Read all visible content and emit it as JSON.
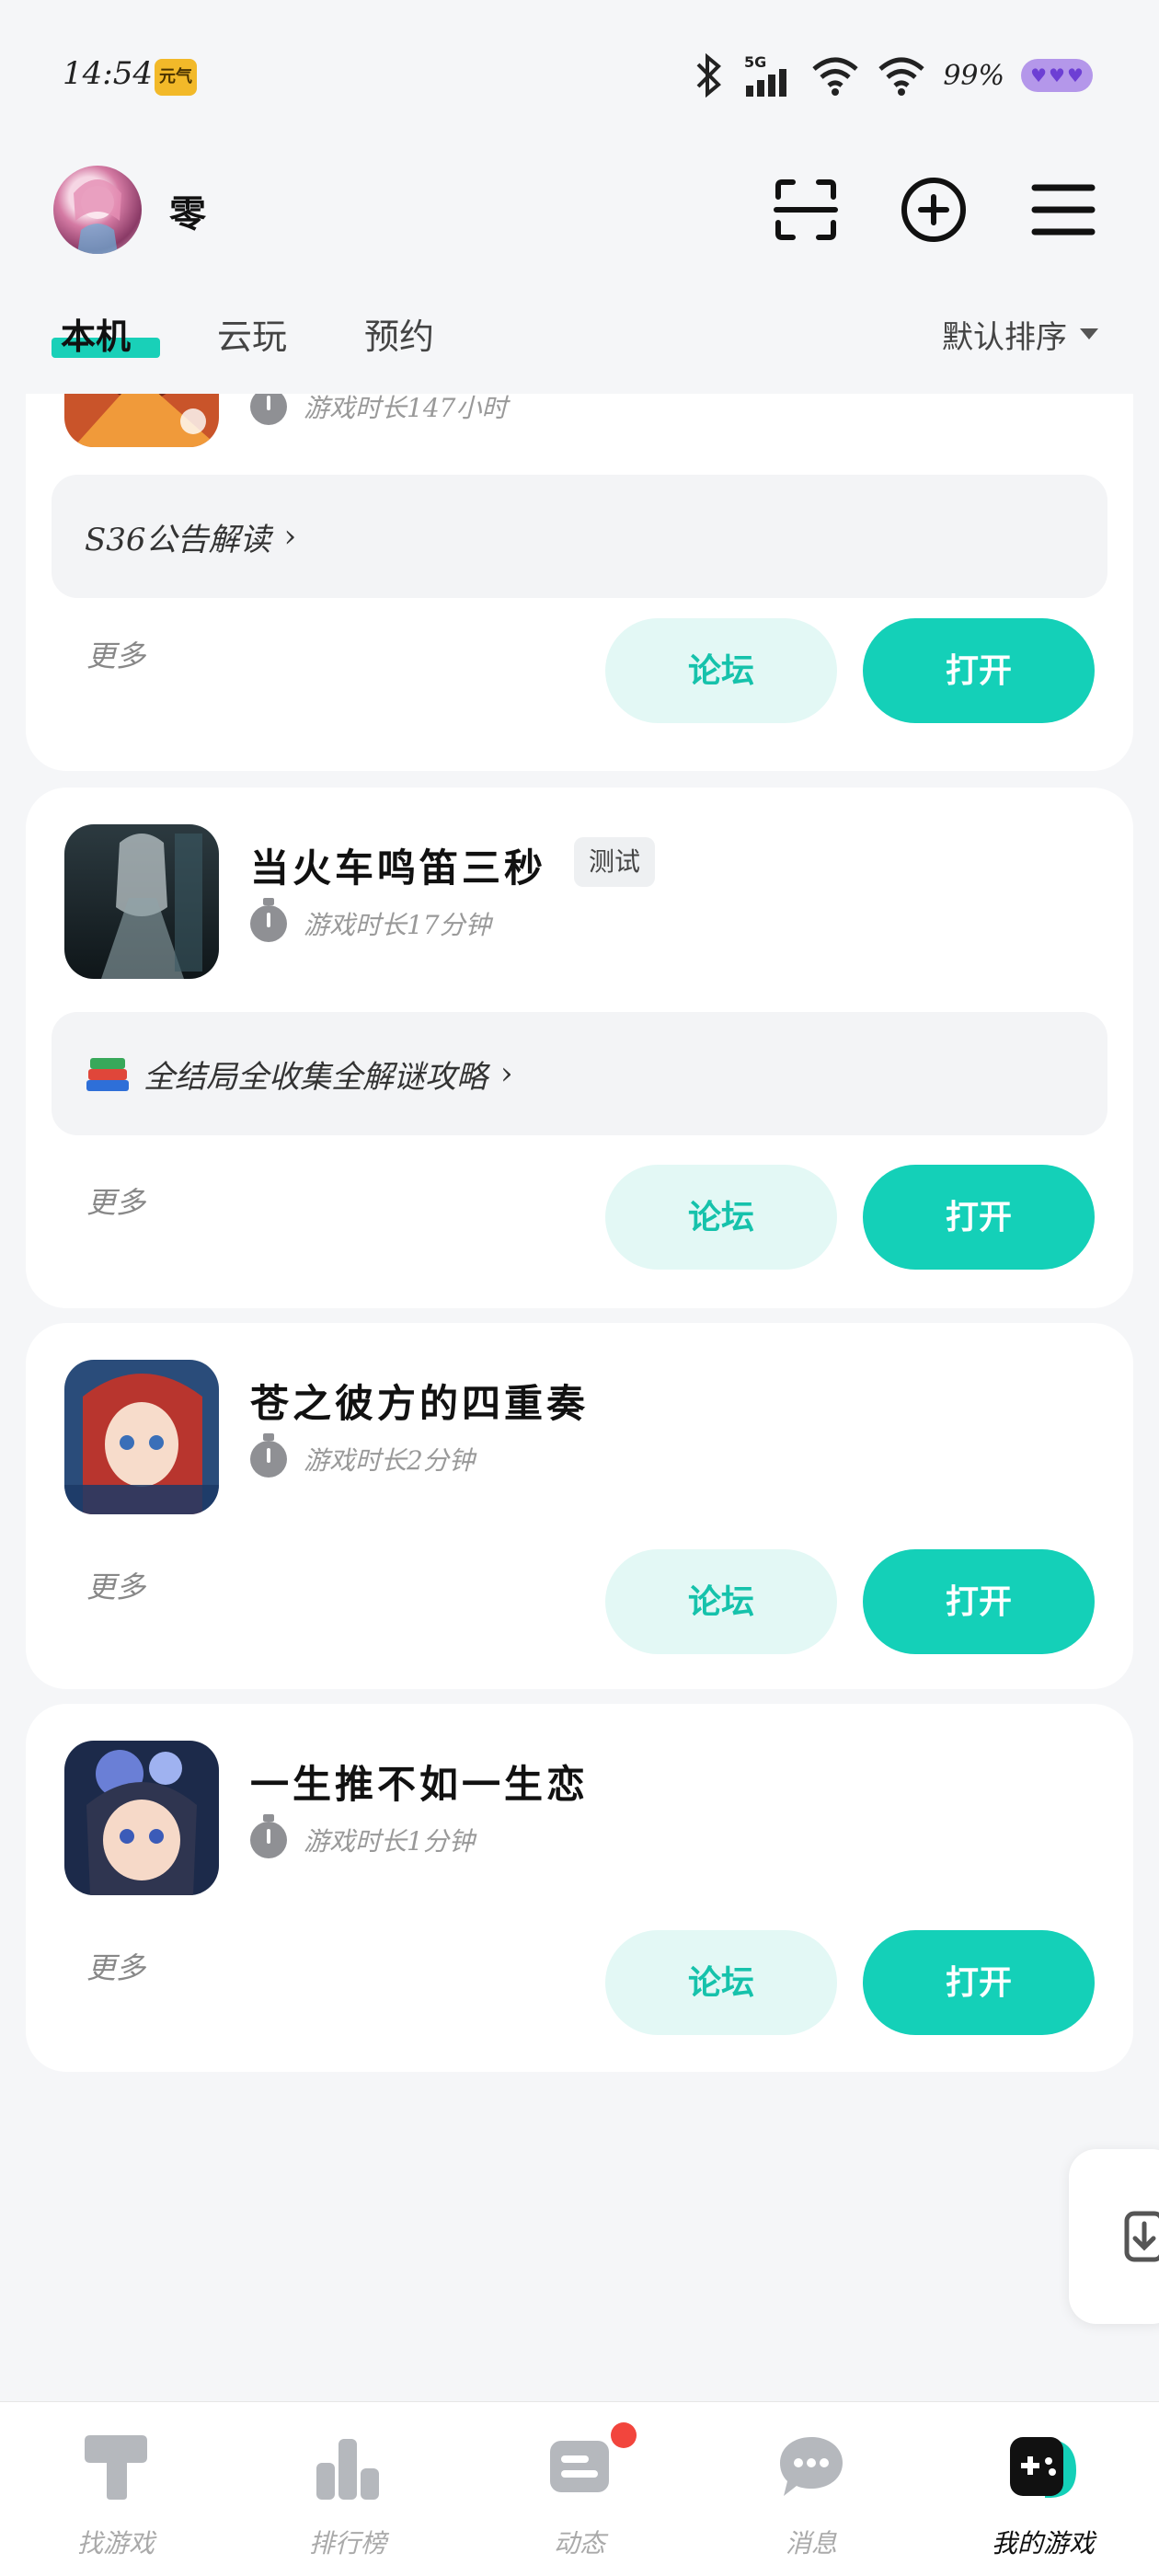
{
  "status_bar": {
    "time": "14:54",
    "badge": "元气",
    "network": "5G",
    "battery_text": "99%"
  },
  "header": {
    "username": "零"
  },
  "tabs": {
    "items": [
      "本机",
      "云玩",
      "预约"
    ],
    "active": "本机",
    "sort_label": "默认排序"
  },
  "games": [
    {
      "title": "",
      "playtime": "游戏时长147小时",
      "guide": "S36公告解读",
      "more": "更多",
      "forum": "论坛",
      "open": "打开"
    },
    {
      "title": "当火车鸣笛三秒",
      "tag": "测试",
      "playtime": "游戏时长17分钟",
      "guide": "全结局全收集全解谜攻略",
      "more": "更多",
      "forum": "论坛",
      "open": "打开"
    },
    {
      "title": "苍之彼方的四重奏",
      "playtime": "游戏时长2分钟",
      "more": "更多",
      "forum": "论坛",
      "open": "打开"
    },
    {
      "title": "一生推不如一生恋",
      "playtime": "游戏时长1分钟",
      "more": "更多",
      "forum": "论坛",
      "open": "打开"
    }
  ],
  "bottom_nav": {
    "items": [
      "找游戏",
      "排行榜",
      "动态",
      "消息",
      "我的游戏"
    ],
    "active": "我的游戏"
  },
  "colors": {
    "accent": "#14d0b8",
    "forum_bg": "#e3f8f5",
    "notification_dot": "#f2453d"
  },
  "icons": {
    "header": [
      "scan-icon",
      "add-circle-icon",
      "menu-icon"
    ],
    "float": "download-icon"
  }
}
